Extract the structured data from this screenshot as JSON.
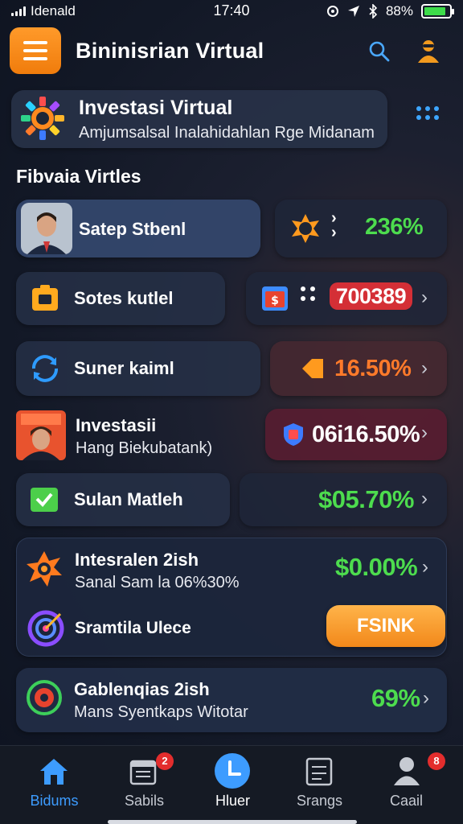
{
  "status": {
    "carrier": "Idenald",
    "time": "17:40",
    "battery": "88%",
    "battery_fraction": 0.88
  },
  "header": {
    "title": "Bininisrian Virtual"
  },
  "invest_card": {
    "title": "Investasi Virtual",
    "subtitle": "Amjumsalsal Inalahidahlan Rge Midanam"
  },
  "section_title": "Fibvaia Virtles",
  "rows": [
    {
      "label": "Satep Stbenl",
      "value": "236%"
    },
    {
      "label": "Sotes kutlel",
      "value": "700389"
    },
    {
      "label": "Suner kaiml",
      "value": "16.50%"
    },
    {
      "label": "Investasii",
      "sublabel": "Hang Biekubatank)",
      "value": "06i16.50%"
    },
    {
      "label": "Sulan Matleh",
      "value": "$05.70%"
    }
  ],
  "combo_card": {
    "title": "Intesralen 2ish",
    "subtitle": "Sanal Sam la 06%30%",
    "value": "$0.00%",
    "second_label": "Sramtila Ulece",
    "button": "FSINK"
  },
  "last_card": {
    "title": "Gablenqias 2ish",
    "subtitle": "Mans Syentkaps Witotar",
    "value": "69%"
  },
  "nav": [
    {
      "label": "Bidums",
      "icon": "home-icon",
      "active": true
    },
    {
      "label": "Sabils",
      "icon": "calendar-icon",
      "badge": "2"
    },
    {
      "label": "Hluer",
      "icon": "clock-icon"
    },
    {
      "label": "Srangs",
      "icon": "document-icon"
    },
    {
      "label": "Caail",
      "icon": "profile-icon",
      "badge": "8"
    }
  ],
  "colors": {
    "accent_orange": "#f28a1e",
    "green": "#4ddc4e",
    "red": "#d42f36",
    "blue": "#3d9cff"
  }
}
